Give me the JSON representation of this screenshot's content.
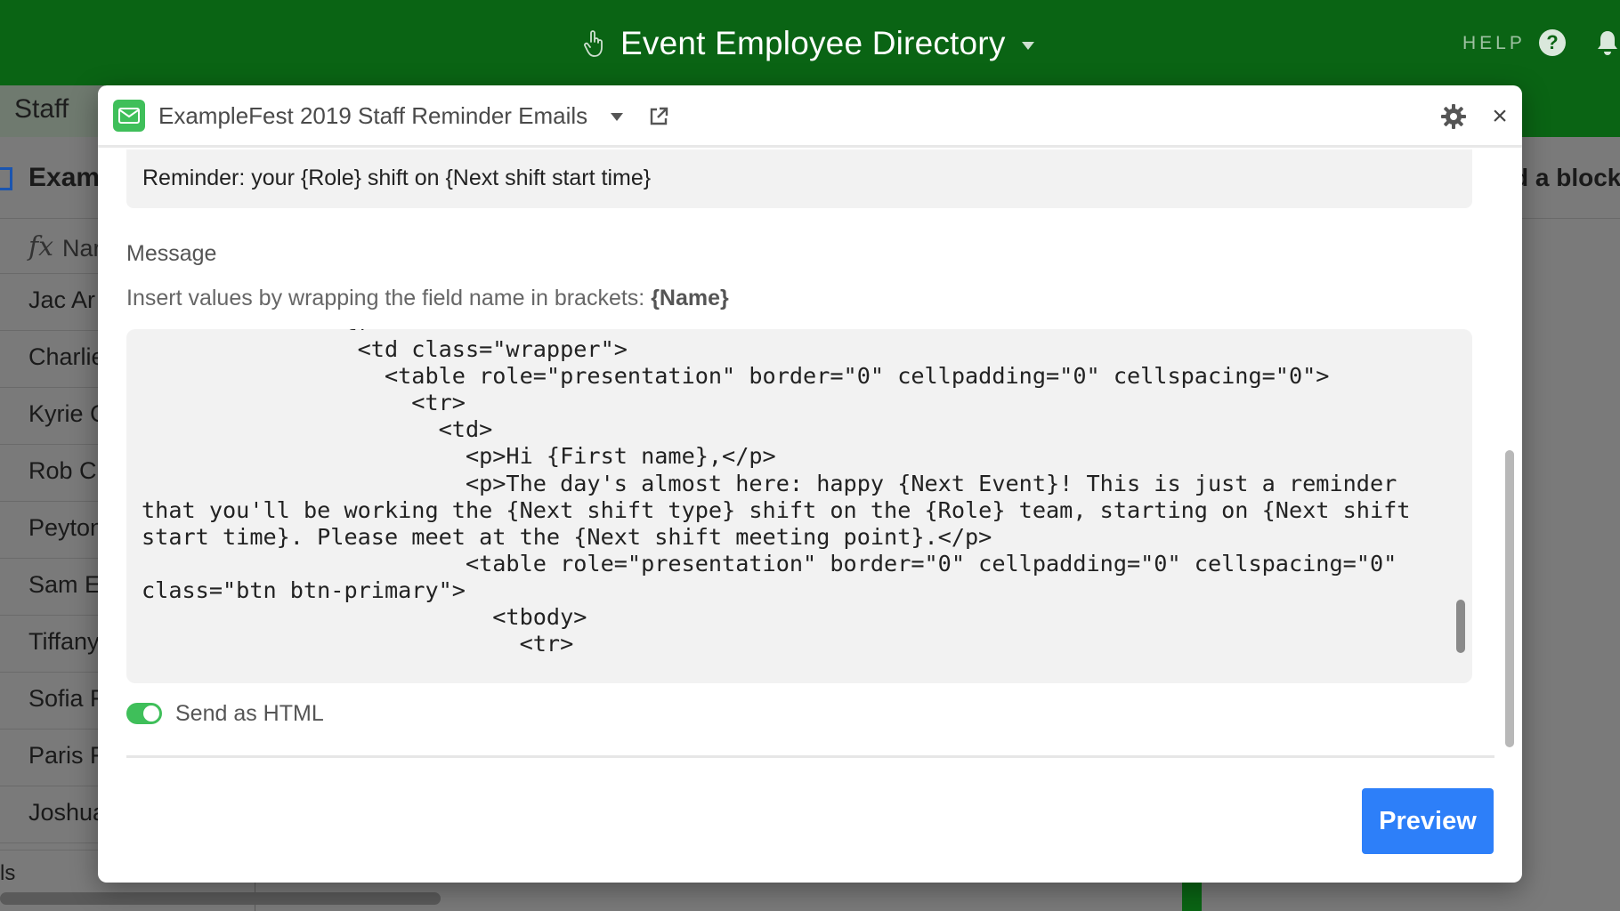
{
  "app": {
    "base_title": "Event Employee Directory",
    "help_label": "HELP",
    "help_glyph": "?"
  },
  "tabs": {
    "active": "Staff"
  },
  "view": {
    "name": "Examp",
    "add_block_label": "d a block"
  },
  "grid": {
    "column_name": "Nar",
    "formula_glyph": "fx",
    "rows": [
      "Jac Ar",
      "Charlie",
      "Kyrie C",
      "Rob Cl",
      "Peyton",
      "Sam E",
      "Tiffany",
      "Sofia F",
      "Paris F",
      "Joshua"
    ],
    "footer_text": "ls"
  },
  "modal": {
    "title": "ExampleFest 2019 Staff Reminder Emails",
    "close_glyph": "×",
    "subject_value": "Reminder: your {Role} shift on {Next shift start time}",
    "message_label": "Message",
    "hint_text": "Insert values by wrapping the field name in brackets: ",
    "hint_token": "{Name}",
    "code": "              <tr>\n                <td class=\"wrapper\">\n                  <table role=\"presentation\" border=\"0\" cellpadding=\"0\" cellspacing=\"0\">\n                    <tr>\n                      <td>\n                        <p>Hi {First name},</p>\n                        <p>The day's almost here: happy {Next Event}! This is just a reminder\nthat you'll be working the {Next shift type} shift on the {Role} team, starting on {Next shift\nstart time}. Please meet at the {Next shift meeting point}.</p>\n                        <table role=\"presentation\" border=\"0\" cellpadding=\"0\" cellspacing=\"0\"\nclass=\"btn btn-primary\">\n                          <tbody>\n                            <tr>",
    "send_as_html_label": "Send as HTML",
    "send_as_html_on": true,
    "preview_label": "Preview"
  },
  "colors": {
    "brand_green": "#0a6414",
    "toggle_green": "#3fbf5a",
    "primary_blue": "#2d7ff9"
  }
}
